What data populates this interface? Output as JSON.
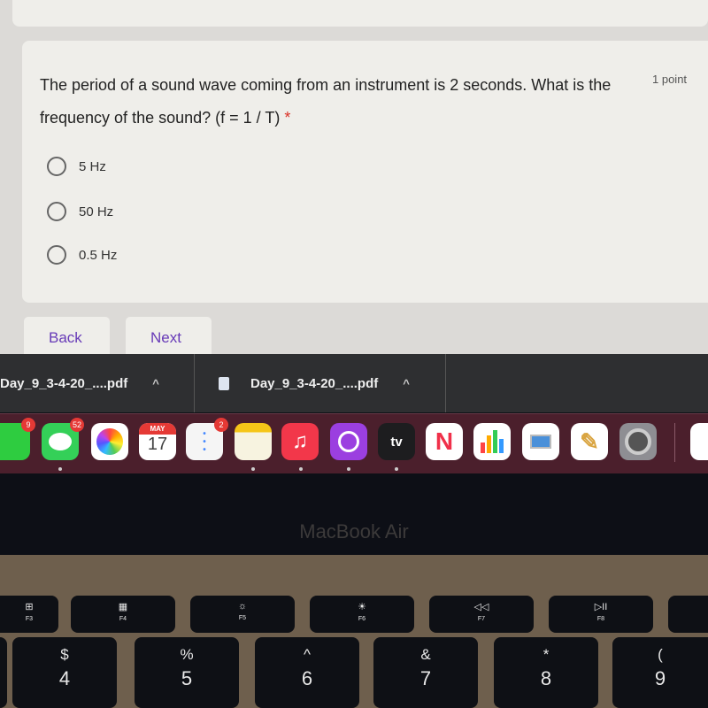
{
  "form": {
    "question": "The period of a sound wave coming from an instrument is 2 seconds. What is the frequency of the sound? (f = 1 / T)",
    "required_mark": "*",
    "points": "1 point",
    "options": [
      "5 Hz",
      "50 Hz",
      "0.5 Hz"
    ],
    "back_label": "Back",
    "next_label": "Next",
    "accent": "#673ab7"
  },
  "downloads": [
    {
      "name": "Day_9_3-4-20_....pdf"
    },
    {
      "name": "Day_9_3-4-20_....pdf"
    }
  ],
  "dock": {
    "apps": [
      {
        "name": "FaceTime",
        "badge": "9",
        "color": "#2ecc40"
      },
      {
        "name": "Messages",
        "badge": "52",
        "color": "#34d058"
      },
      {
        "name": "Photos",
        "badge": null,
        "color": "#ffffff"
      },
      {
        "name": "Calendar",
        "month": "MAY",
        "day": "17",
        "badge": null,
        "color": "#ffffff"
      },
      {
        "name": "Reminders",
        "badge": "2",
        "color": "#f5f5f5"
      },
      {
        "name": "Notes",
        "badge": null,
        "color": "#f7f3e0"
      },
      {
        "name": "Music",
        "symbol": "♫",
        "badge": null,
        "color": "#f2374a"
      },
      {
        "name": "Podcasts",
        "badge": null,
        "color": "#9b3fe0"
      },
      {
        "name": "TV",
        "symbol": "tv",
        "badge": null,
        "color": "#1d1d1f"
      },
      {
        "name": "News",
        "symbol": "N",
        "badge": null,
        "color": "#ffffff"
      },
      {
        "name": "Numbers",
        "badge": null,
        "color": "#ffffff"
      },
      {
        "name": "Keynote",
        "badge": null,
        "color": "#ffffff"
      },
      {
        "name": "Pages",
        "badge": null,
        "color": "#ffffff"
      },
      {
        "name": "System Preferences",
        "badge": null,
        "color": "#8e8e93"
      }
    ]
  },
  "laptop": {
    "brand": "MacBook Air"
  },
  "keyboard": {
    "fkeys": [
      {
        "sym": "⊞",
        "label": "F3"
      },
      {
        "sym": "▦",
        "label": "F4"
      },
      {
        "sym": "☼",
        "label": "F5"
      },
      {
        "sym": "☀",
        "label": "F6"
      },
      {
        "sym": "◁◁",
        "label": "F7"
      },
      {
        "sym": "▷II",
        "label": "F8"
      }
    ],
    "number_keys": [
      {
        "shift": "$",
        "num": "4"
      },
      {
        "shift": "%",
        "num": "5"
      },
      {
        "shift": "^",
        "num": "6"
      },
      {
        "shift": "&",
        "num": "7"
      },
      {
        "shift": "*",
        "num": "8"
      },
      {
        "shift": "(",
        "num": "9"
      }
    ]
  }
}
